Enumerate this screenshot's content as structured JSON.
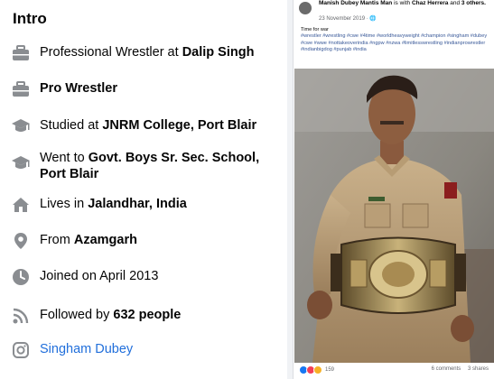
{
  "intro": {
    "title": "Intro",
    "items": [
      {
        "icon": "briefcase-icon",
        "prefix": "Professional Wrestler at ",
        "bold": "Dalip Singh",
        "suffix": ""
      },
      {
        "icon": "briefcase-icon",
        "prefix": "",
        "bold": "Pro Wrestler",
        "suffix": ""
      },
      {
        "icon": "graduation-cap-icon",
        "prefix": "Studied at ",
        "bold": "JNRM College, Port Blair",
        "suffix": ""
      },
      {
        "icon": "graduation-cap-icon",
        "prefix": "Went to ",
        "bold": "Govt. Boys Sr. Sec. School, Port Blair",
        "suffix": ""
      },
      {
        "icon": "home-icon",
        "prefix": "Lives in ",
        "bold": "Jalandhar, India",
        "suffix": ""
      },
      {
        "icon": "location-pin-icon",
        "prefix": "From ",
        "bold": "Azamgarh",
        "suffix": ""
      },
      {
        "icon": "clock-icon",
        "prefix": "Joined on April 2013",
        "bold": "",
        "suffix": ""
      },
      {
        "icon": "rss-icon",
        "prefix": "Followed by ",
        "bold": "632 people",
        "suffix": ""
      },
      {
        "icon": "instagram-icon",
        "link": "Singham Dubey"
      }
    ]
  },
  "post": {
    "author": "Manish Dubey Mantis Man",
    "with_text": " is with ",
    "tagged": "Chaz Herrera",
    "and_text": " and ",
    "others": "3 others.",
    "date": "23 November 2019 · ",
    "globe": "🌐",
    "caption": "Time for war",
    "hashtags": "#wrestler #wrestling #cwe #4time #worldheavyweight #champion #singham #dubey #cwe #wwe #nottakeoverindia #ngpw #nzwa #limitlesswrestling #indianprowrestler #indianbigdog #punjab #india",
    "reaction_count": "159",
    "comments": "6 comments",
    "shares": "3 shares",
    "colors": {
      "like": "#1877f2",
      "love": "#f33e58",
      "haha": "#f7b125"
    }
  }
}
